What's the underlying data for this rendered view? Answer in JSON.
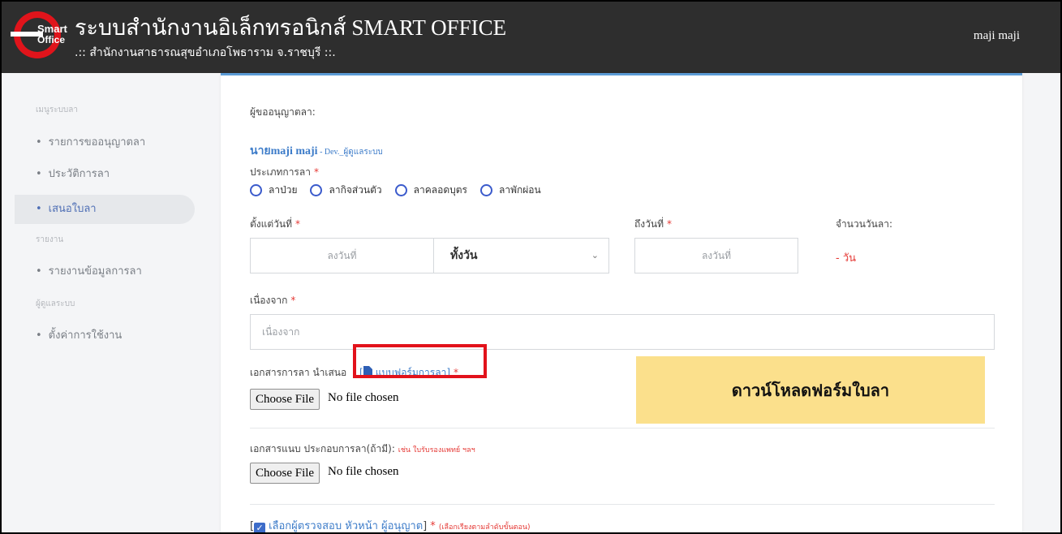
{
  "header": {
    "logo_line1": "Smart",
    "logo_line2": "Office",
    "title": "ระบบสำนักงานอิเล็กทรอนิกส์ SMART OFFICE",
    "subtitle": ".:: สำนักงานสาธารณสุขอำเภอโพธาราม จ.ราชบุรี ::.",
    "user": "maji maji"
  },
  "sidebar": {
    "headings": [
      "เมนูระบบลา",
      "รายงาน",
      "ผู้ดูแลระบบ"
    ],
    "items": [
      {
        "label": "รายการขออนุญาตลา"
      },
      {
        "label": "ประวัติการลา"
      },
      {
        "label": "เสนอใบลา"
      },
      {
        "label": "รายงานข้อมูลการลา"
      },
      {
        "label": "ตั้งค่าการใช้งาน"
      }
    ],
    "bullet": "•"
  },
  "form": {
    "requester_label": "ผู้ขออนุญาตลา:",
    "requester_name": "นายmaji maji",
    "requester_role": " - Dev._ผู้ดูแลระบบ",
    "leave_type_label": "ประเภทการลา",
    "required_mark": "*",
    "leave_types": [
      "ลาป่วย",
      "ลากิจส่วนตัว",
      "ลาคลอดบุตร",
      "ลาพักผ่อน"
    ],
    "from_date_label": "ตั้งแต่วันที่",
    "from_date_placeholder": "ลงวันที่",
    "period_value": "ทั้งวัน",
    "to_date_label": "ถึงวันที่",
    "to_date_placeholder": "ลงวันที่",
    "days_label": "จำนวนวันลา:",
    "days_value": "- วัน",
    "reason_label": "เนื่องจาก",
    "reason_placeholder": "เนื่องจาก",
    "doc_label": "เอกสารการลา นำเสนอ",
    "doc_link_open": "[",
    "doc_link": "แบบฟอร์มการลา",
    "doc_link_close": "]",
    "choose_file": "Choose File",
    "no_file": "No file chosen",
    "attach_label": "เอกสารแนบ ประกอบการลา(ถ้ามี):",
    "attach_note": "เช่น ใบรับรองแพทย์ ฯลฯ",
    "choose_file_2": "Choose File",
    "no_file_2": "No file chosen",
    "approver_open": "[",
    "approver_text": "เลือกผู้ตรวจสอบ หัวหน้า ผู้อนุญาต",
    "approver_close": "]",
    "approver_note": "(เลือกเรียงตามลำดับขั้นตอน)"
  },
  "callout": {
    "text": "ดาวน์โหลดฟอร์มใบลา"
  },
  "colors": {
    "header_bg": "#2e2e2e",
    "accent_blue": "#3d7cc9",
    "required_red": "#e53935",
    "highlight_box": "#e2121b",
    "callout_bg": "#fbe08c"
  }
}
